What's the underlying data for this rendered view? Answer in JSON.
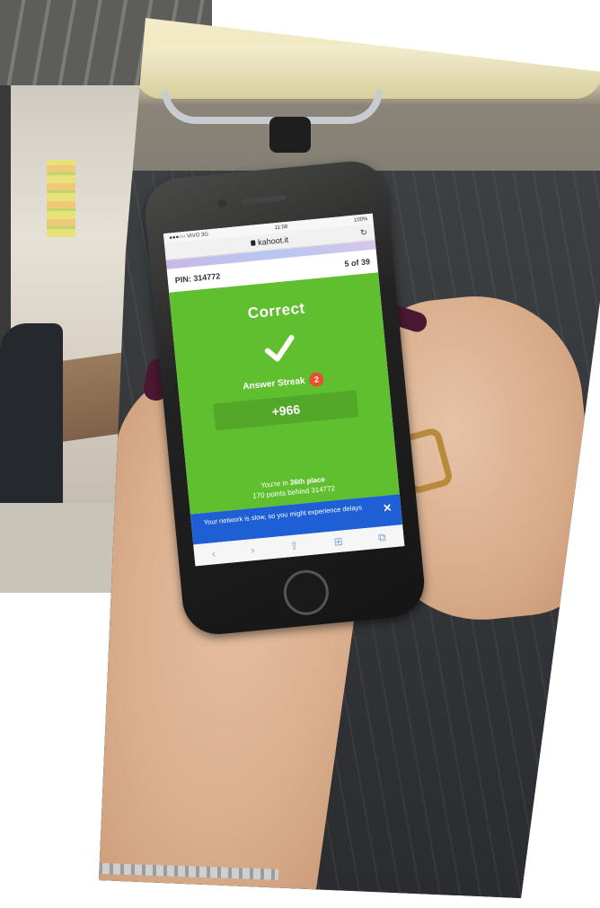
{
  "status_bar": {
    "carrier": "●●●○○ VIVO 3G",
    "time": "11:58",
    "battery": "100%"
  },
  "browser": {
    "url": "kahoot.it",
    "reload_icon": "reload-icon"
  },
  "game": {
    "pin_label": "PIN: 314772",
    "question_progress": "5 of 39",
    "result_title": "Correct",
    "streak_label": "Answer Streak",
    "streak_count": "2",
    "points": "+966",
    "place_prefix": "You're in ",
    "place_value": "36th place",
    "points_behind": "170 points behind 314772"
  },
  "toast": {
    "message": "Your network is slow, so you might experience delays",
    "close_label": "✕"
  },
  "toolbar": {
    "back": "‹",
    "forward": "›",
    "share": "⇪",
    "bookmarks": "⊞",
    "tabs": "⧉"
  },
  "colors": {
    "correct_green": "#5fbf2f",
    "streak_badge": "#e8502e",
    "toast_blue": "#1e5fd6",
    "nail_polish": "#4a1830"
  }
}
